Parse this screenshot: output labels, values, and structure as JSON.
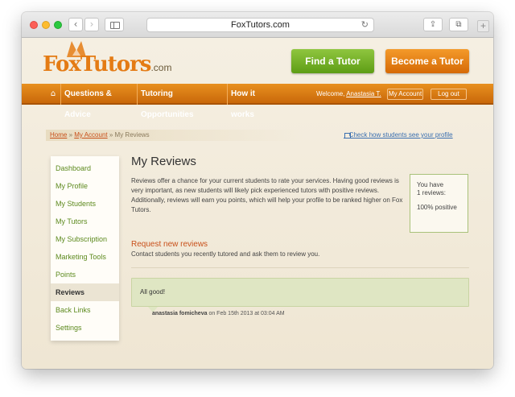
{
  "browser": {
    "url": "FoxTutors.com",
    "back_glyph": "‹",
    "forward_glyph": "›",
    "reload_glyph": "↻",
    "share_glyph": "⇪",
    "tabs_glyph": "⧉",
    "newtab_glyph": "+"
  },
  "site": {
    "logo_main": "FoxTutors",
    "logo_suffix": ".com",
    "accent": "#e47b14",
    "find_tutor": "Find a Tutor",
    "become_tutor": "Become a Tutor"
  },
  "nav": {
    "home_glyph": "⌂",
    "items": [
      "Questions & Advice",
      "Tutoring Opportunities",
      "How it works"
    ],
    "welcome_prefix": "Welcome,",
    "welcome_name": "Anastasia T.",
    "my_account": "My Account",
    "logout": "Log out"
  },
  "breadcrumb": {
    "home": "Home",
    "sep1": "»",
    "account": "My Account",
    "sep2": "»",
    "current": "My Reviews"
  },
  "check_profile_link": "Check how students see your profile",
  "sidebar": {
    "items": [
      "Dashboard",
      "My Profile",
      "My Students",
      "My Tutors",
      "My Subscription",
      "Marketing Tools",
      "Points",
      "Reviews",
      "Back Links",
      "Settings"
    ],
    "active": "Reviews"
  },
  "main": {
    "title": "My Reviews",
    "intro": "Reviews offer a chance for your current students to rate your services. Having good reviews is very important, as new students will likely pick experienced tutors with positive reviews. Additionally, reviews will earn you points, which will help your profile to be ranked higher on Fox Tutors.",
    "stats": {
      "line1": "You have",
      "line2": "1 reviews:",
      "positive": "100% positive"
    },
    "request_title": "Request new reviews",
    "request_sub": "Contact students you recently tutored and ask them to review you.",
    "review": {
      "text": "All good!",
      "author": "anastasia fomicheva",
      "date": "on Feb 15th 2013 at 03:04 AM"
    }
  }
}
